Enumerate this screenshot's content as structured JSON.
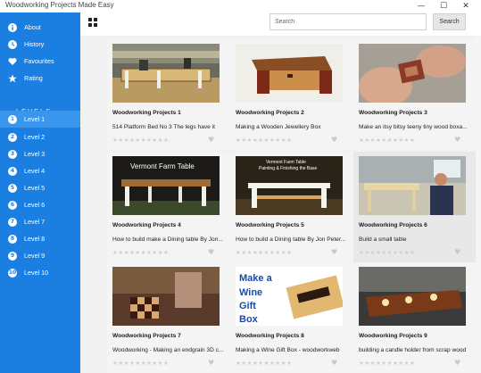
{
  "window": {
    "title": "Woodworking Projects Made Easy",
    "minimize": "—",
    "maximize": "☐",
    "close": "✕"
  },
  "sidebar": {
    "nav": [
      {
        "label": "About",
        "icon": "info-icon"
      },
      {
        "label": "History",
        "icon": "history-icon"
      },
      {
        "label": "Favourites",
        "icon": "heart-icon"
      },
      {
        "label": "Rating",
        "icon": "star-icon"
      }
    ],
    "levels_heading": "LEVELS",
    "levels": [
      {
        "num": "1",
        "label": "Level 1",
        "active": true
      },
      {
        "num": "2",
        "label": "Level 2"
      },
      {
        "num": "3",
        "label": "Level 3"
      },
      {
        "num": "4",
        "label": "Level 4"
      },
      {
        "num": "5",
        "label": "Level 5"
      },
      {
        "num": "6",
        "label": "Level 6"
      },
      {
        "num": "7",
        "label": "Level 7"
      },
      {
        "num": "8",
        "label": "Level 8"
      },
      {
        "num": "9",
        "label": "Level 9"
      },
      {
        "num": "10",
        "label": "Level 10"
      }
    ]
  },
  "toolbar": {
    "search_placeholder": "Search",
    "search_button": "Search"
  },
  "cards": [
    {
      "title": "Woodworking Projects 1",
      "subtitle": "514 Platform Bed No 3 The legs have it",
      "rating": 0
    },
    {
      "title": "Woodworking Projects 2",
      "subtitle": "Making a Wooden Jewellery Box",
      "rating": 0
    },
    {
      "title": "Woodworking Projects 3",
      "subtitle": "Make an itsy bitsy teeny tiny wood boxa...",
      "rating": 0
    },
    {
      "title": "Woodworking Projects 4",
      "subtitle": "How to build make a Dining table By Jon...",
      "rating": 0,
      "thumb_text": "Vermont Farm Table"
    },
    {
      "title": "Woodworking Projects 5",
      "subtitle": "How to build a Dining table By Jon Peter...",
      "rating": 0,
      "thumb_text": "Vermont Farm Table\nPainting & Finishing the Base"
    },
    {
      "title": "Woodworking Projects 6",
      "subtitle": "Build a small table",
      "rating": 0
    },
    {
      "title": "Woodworking Projects 7",
      "subtitle": "Woodworking - Making an endgrain 3D c...",
      "rating": 0
    },
    {
      "title": "Woodworking Projects 8",
      "subtitle": "Making a Wine Gift Box - woodworkweb",
      "rating": 0,
      "thumb_text": "Make a Wine Gift Box"
    },
    {
      "title": "Woodworking Projects 9",
      "subtitle": "building a candle holder from scrap wood",
      "rating": 0
    }
  ],
  "colors": {
    "sidebar": "#1a7fe0",
    "sidebar_active": "#3a95ec",
    "card_bg": "#f4f4f4"
  }
}
